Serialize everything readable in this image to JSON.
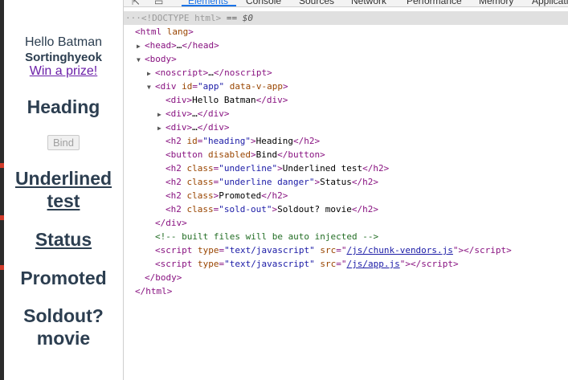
{
  "preview": {
    "hello_text": "Hello Batman",
    "user_text": "Sortinghyeok",
    "prize_link": "Win a prize!",
    "heading_text": "Heading",
    "bind_button": "Bind",
    "underlined_text": "Underlined test",
    "status_text": "Status",
    "promoted_text": "Promoted",
    "soldout_text": "Soldout? movie"
  },
  "devtools": {
    "tabs": [
      "Elements",
      "Console",
      "Sources",
      "Network",
      "Performance",
      "Memory",
      "Application"
    ],
    "active_tab": "Elements",
    "doctype_line": "<!DOCTYPE html>",
    "doctype_hint": "== $0",
    "html_open": "html",
    "html_attr": "lang",
    "head_tag": "head",
    "ellipsis": "…",
    "body_tag": "body",
    "noscript_tag": "noscript",
    "div_tag": "div",
    "attr_id": "id",
    "app_id": "\"app\"",
    "data_attr": "data-v-app",
    "hello_text": "Hello Batman",
    "h2_tag": "h2",
    "heading_id": "\"heading\"",
    "heading_text": "Heading",
    "button_tag": "button",
    "disabled_attr": "disabled",
    "bind_text": "Bind",
    "attr_class": "class",
    "underline_class": "\"underline\"",
    "underlined_text": "Underlined test",
    "underline_danger_class": "\"underline danger\"",
    "status_text": "Status",
    "promoted_text": "Promoted",
    "soldout_class": "\"sold-out\"",
    "soldout_text": "Soldout? movie",
    "comment_text": "<!-- built files will be auto injected -->",
    "script_tag": "script",
    "attr_type": "type",
    "type_val": "\"text/javascript\"",
    "attr_src": "src",
    "src_chunk": "/js/chunk-vendors.js",
    "src_app": "/js/app.js"
  },
  "colors": {
    "tag": "#881280",
    "attr_name": "#994500",
    "attr_value": "#1a1aa6",
    "comment": "#236e25",
    "preview_text": "#2c3e50",
    "link": "#6b1fa8",
    "active_tab": "#1a73e8"
  },
  "icons": [
    "select-element-icon",
    "device-toolbar-icon",
    "expand-triangle-icon",
    "collapse-triangle-icon"
  ]
}
